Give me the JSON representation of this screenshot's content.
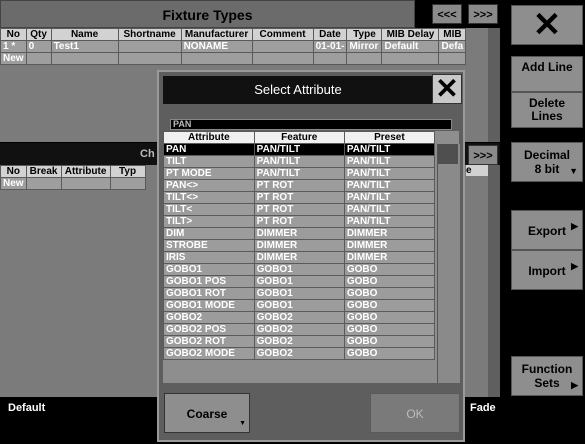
{
  "fixture_types": {
    "title": "Fixture Types",
    "nav_prev": "<<<",
    "nav_next": ">>>",
    "columns": [
      "No",
      "Qty",
      "Name",
      "Shortname",
      "Manufacturer",
      "Comment",
      "Date",
      "Type",
      "MIB Delay",
      "MIB"
    ],
    "rows": [
      [
        "1 *",
        "0",
        "Test1",
        "",
        "NONAME",
        "",
        "01-01-",
        "Mirror",
        "Default",
        "Defa"
      ]
    ],
    "new_label": "New"
  },
  "channels": {
    "title_partial": "Ch",
    "nav_next": ">>>",
    "columns": [
      "No",
      "Break",
      "Attribute",
      "Typ"
    ],
    "right_partial": "e",
    "new_label": "New"
  },
  "sidebar": {
    "close": "✕",
    "add_line": "Add Line",
    "delete_lines": "Delete Lines",
    "decimal_line1": "Decimal",
    "decimal_line2": "8 bit",
    "export": "Export",
    "import": "Import",
    "function_sets_line1": "Function",
    "function_sets_line2": "Sets"
  },
  "bottom": {
    "default_label": "Default",
    "fade_label": "Fade"
  },
  "dialog": {
    "title": "Select Attribute",
    "close": "✕",
    "search_value": "PAN",
    "columns": [
      "Attribute",
      "Feature",
      "Preset"
    ],
    "rows": [
      [
        "PAN",
        "PAN/TILT",
        "PAN/TILT"
      ],
      [
        "TILT",
        "PAN/TILT",
        "PAN/TILT"
      ],
      [
        "PT MODE",
        "PAN/TILT",
        "PAN/TILT"
      ],
      [
        "PAN<>",
        "PT ROT",
        "PAN/TILT"
      ],
      [
        "TILT<>",
        "PT ROT",
        "PAN/TILT"
      ],
      [
        "TILT<",
        "PT ROT",
        "PAN/TILT"
      ],
      [
        "TILT>",
        "PT ROT",
        "PAN/TILT"
      ],
      [
        "DIM",
        "DIMMER",
        "DIMMER"
      ],
      [
        "STROBE",
        "DIMMER",
        "DIMMER"
      ],
      [
        "IRIS",
        "DIMMER",
        "DIMMER"
      ],
      [
        "GOBO1",
        "GOBO1",
        "GOBO"
      ],
      [
        "GOBO1 POS",
        "GOBO1",
        "GOBO"
      ],
      [
        "GOBO1 ROT",
        "GOBO1",
        "GOBO"
      ],
      [
        "GOBO1 MODE",
        "GOBO1",
        "GOBO"
      ],
      [
        "GOBO2",
        "GOBO2",
        "GOBO"
      ],
      [
        "GOBO2 POS",
        "GOBO2",
        "GOBO"
      ],
      [
        "GOBO2 ROT",
        "GOBO2",
        "GOBO"
      ],
      [
        "GOBO2 MODE",
        "GOBO2",
        "GOBO"
      ]
    ],
    "coarse_button": "Coarse",
    "ok_button": "OK"
  }
}
